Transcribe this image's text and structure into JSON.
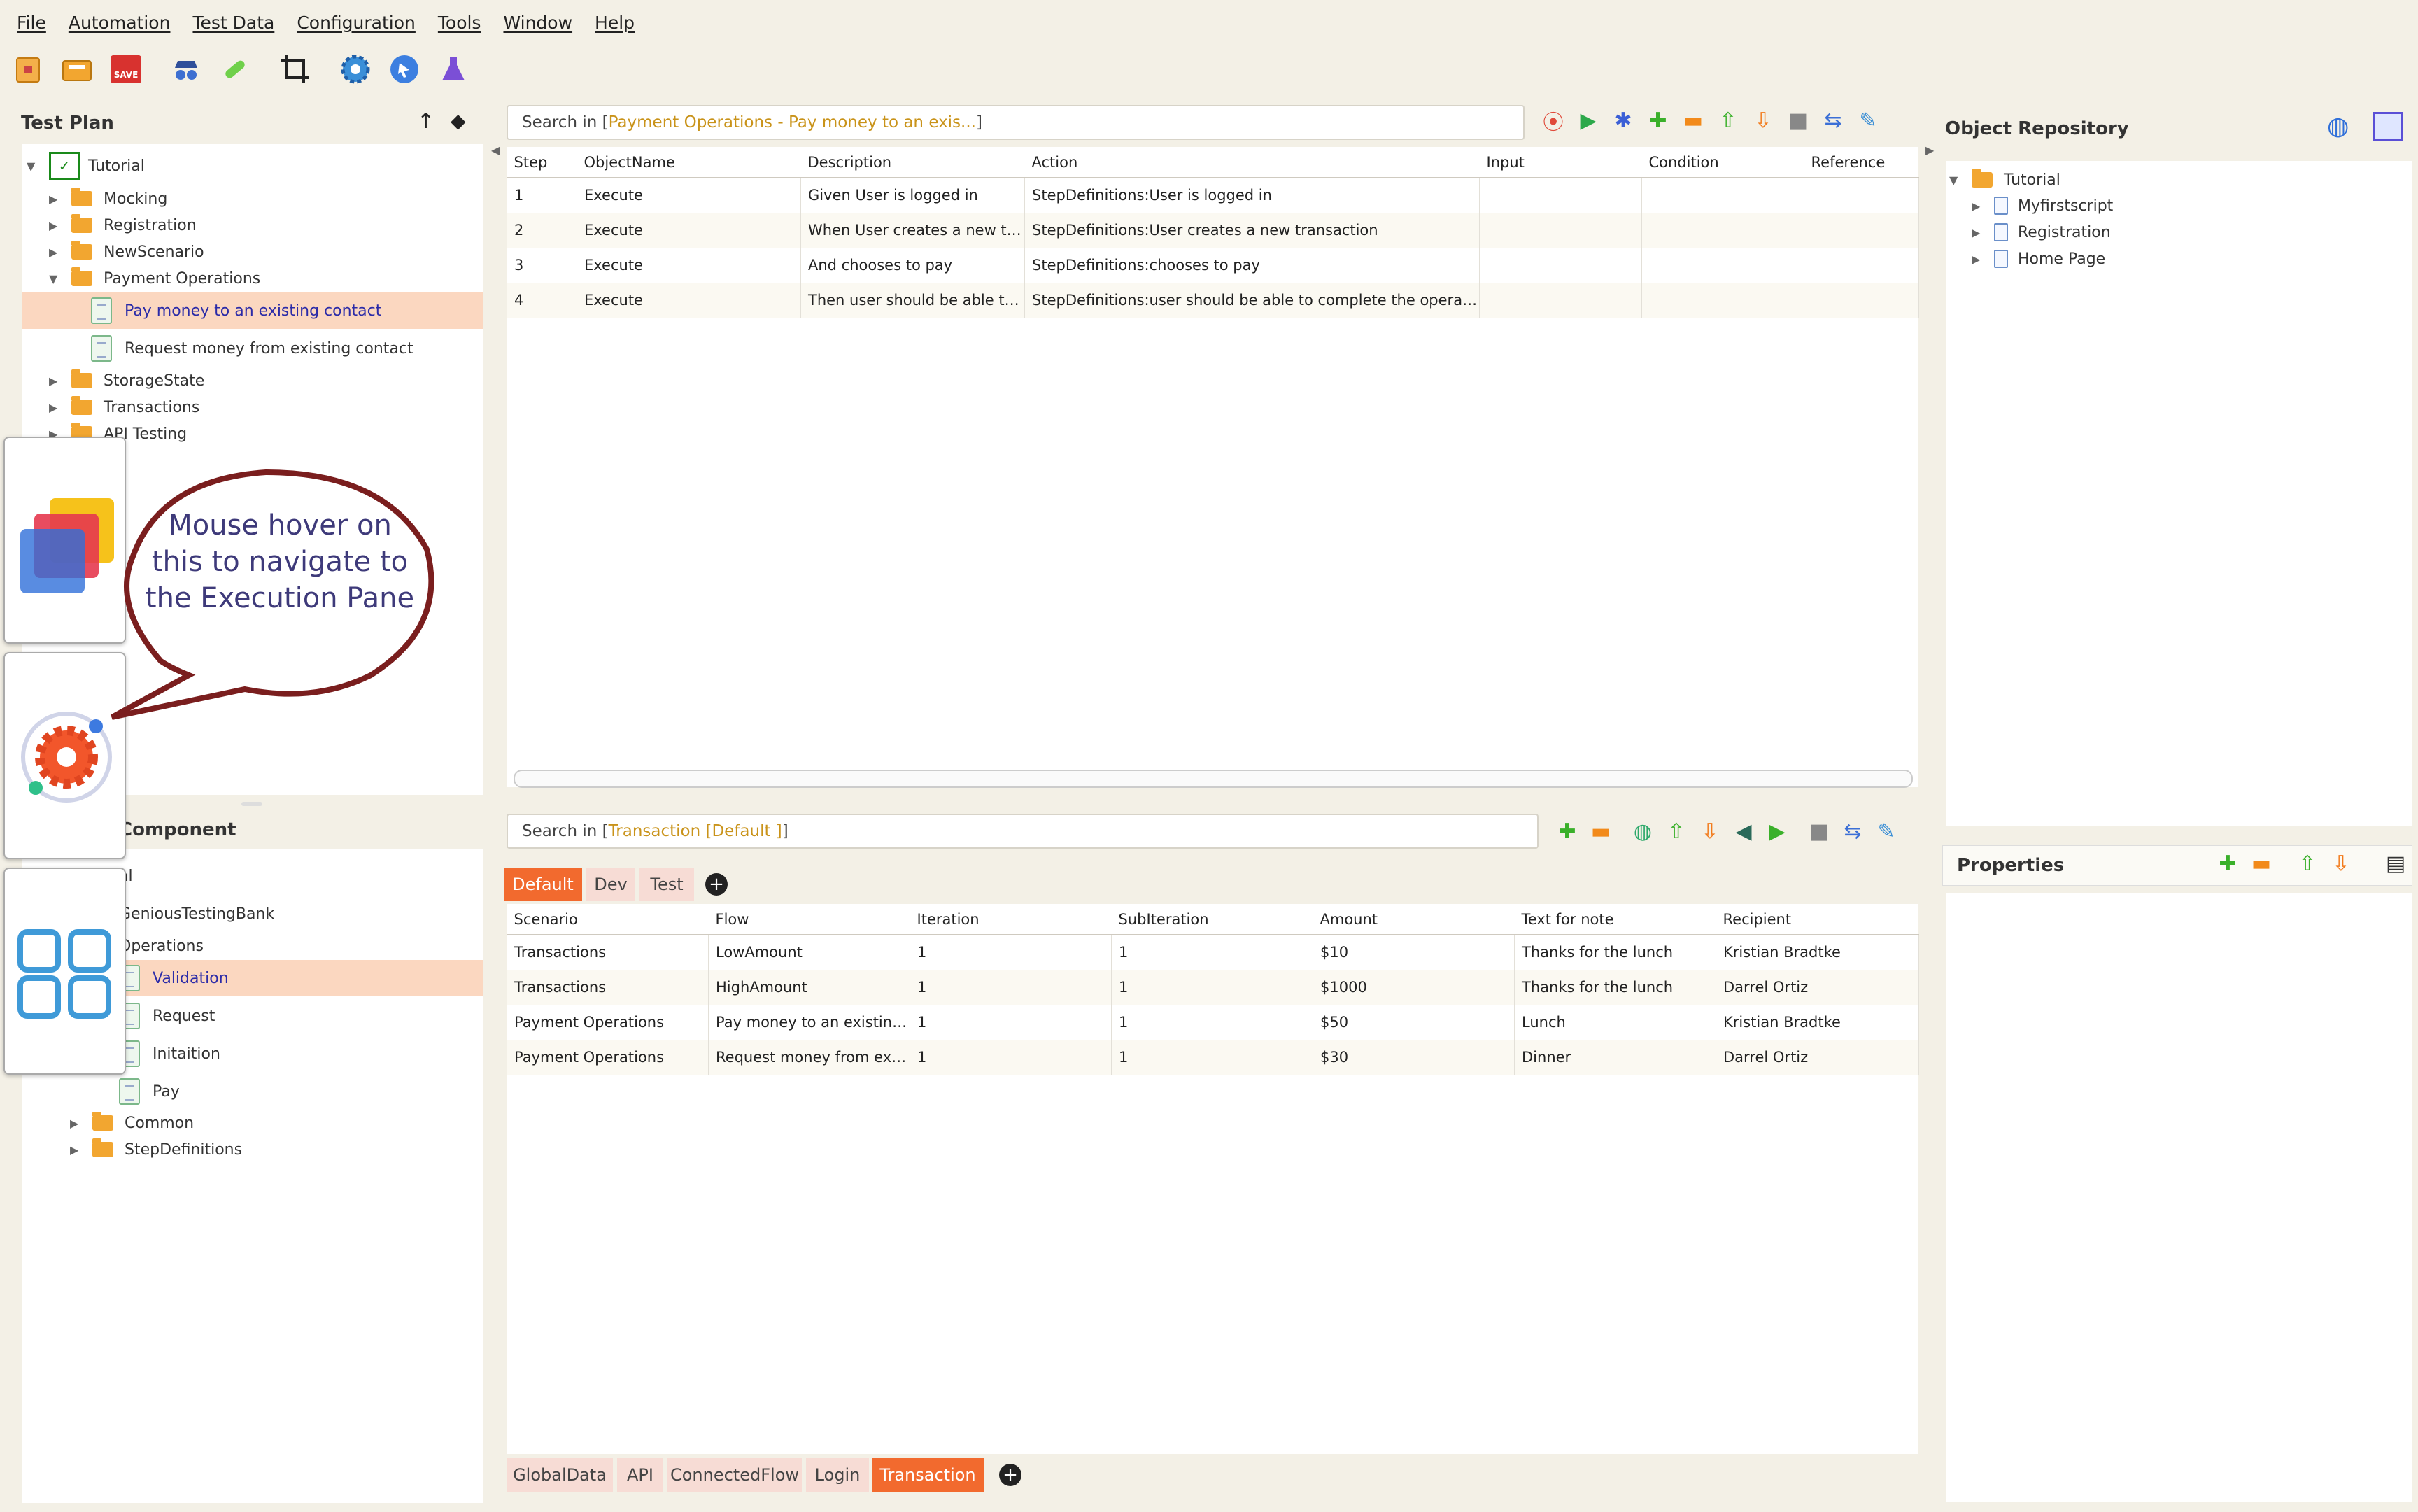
{
  "menu": [
    "File",
    "Automation",
    "Test Data",
    "Configuration",
    "Tools",
    "Window",
    "Help"
  ],
  "toolbar_icons": [
    "open-icon",
    "folder-icon",
    "save-icon",
    "spy-icon",
    "bandage-icon",
    "crop-icon",
    "gear-icon",
    "target-icon",
    "flask-icon"
  ],
  "toolbar": {
    "save_text": "SAVE"
  },
  "test_plan": {
    "title": "Test Plan",
    "root": "Tutorial",
    "items": [
      "Mocking",
      "Registration",
      "NewScenario",
      "Payment Operations"
    ],
    "children": [
      "Pay money to an existing contact",
      "Request money from existing contact"
    ],
    "after": [
      "StorageState",
      "Transactions",
      "API Testing"
    ]
  },
  "component": {
    "title": "Component",
    "items": [
      "al",
      "GeniousTestingBank",
      "Operations"
    ],
    "children": [
      "Validation",
      "Request",
      "Initaition",
      "Pay"
    ],
    "after": [
      "Common",
      "StepDefinitions"
    ]
  },
  "callout": {
    "text": "Mouse hover on this to navigate to the Execution Pane"
  },
  "steps_pane": {
    "search_prefix": "Search in [ ",
    "search_highlight": "Payment Operations - Pay money to an exis...",
    "search_suffix": " ]",
    "columns": [
      "Step",
      "ObjectName",
      "Description",
      "Action",
      "Input",
      "Condition",
      "Reference"
    ],
    "rows": [
      [
        "1",
        "Execute",
        "Given  User is logged in",
        "StepDefinitions:User is logged in",
        "",
        "",
        ""
      ],
      [
        "2",
        "Execute",
        "When  User creates a new tr...",
        "StepDefinitions:User creates a new transaction",
        "",
        "",
        ""
      ],
      [
        "3",
        "Execute",
        "And  chooses to pay",
        "StepDefinitions:chooses to pay",
        "",
        "",
        ""
      ],
      [
        "4",
        "Execute",
        "Then  user should be able to ...",
        "StepDefinitions:user should be able to complete the operation",
        "",
        "",
        ""
      ]
    ]
  },
  "data_pane": {
    "search_prefix": "Search in [ ",
    "search_highlight": "Transaction [Default ]",
    "search_suffix": " ]",
    "env_tabs": [
      "Default",
      "Dev",
      "Test"
    ],
    "columns": [
      "Scenario",
      "Flow",
      "Iteration",
      "SubIteration",
      "Amount",
      "Text for note",
      "Recipient"
    ],
    "rows": [
      [
        "Transactions",
        "LowAmount",
        "1",
        "1",
        "$10",
        "Thanks for the lunch",
        "Kristian Bradtke"
      ],
      [
        "Transactions",
        "HighAmount",
        "1",
        "1",
        "$1000",
        "Thanks for the lunch",
        "Darrel Ortiz"
      ],
      [
        "Payment Operations",
        "Pay money to an existing...",
        "1",
        "1",
        "$50",
        "Lunch",
        "Kristian Bradtke"
      ],
      [
        "Payment Operations",
        "Request money from exi...",
        "1",
        "1",
        "$30",
        "Dinner",
        "Darrel Ortiz"
      ]
    ],
    "sheet_tabs": [
      "GlobalData",
      "API",
      "ConnectedFlow",
      "Login",
      "Transaction"
    ]
  },
  "object_repository": {
    "title": "Object Repository",
    "root": "Tutorial",
    "items": [
      "Myfirstscript",
      "Registration",
      "Home Page"
    ]
  },
  "properties": {
    "title": "Properties"
  }
}
